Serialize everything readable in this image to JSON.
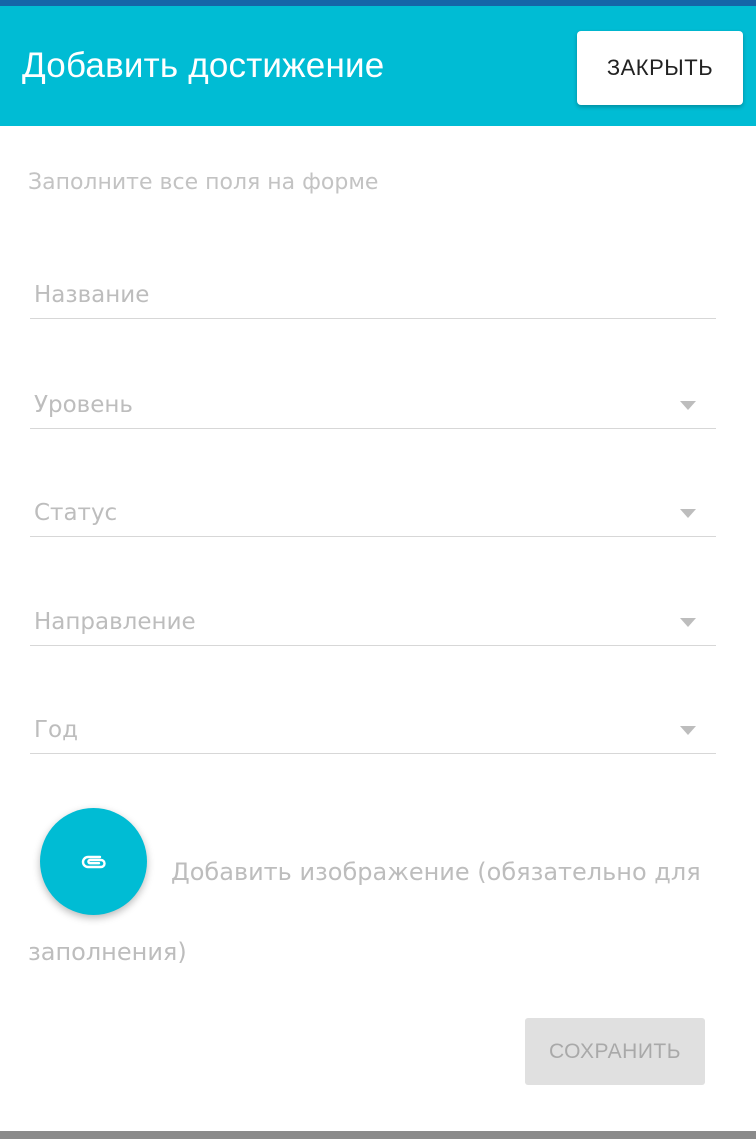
{
  "dialog": {
    "title": "Добавить достижение",
    "close_label": "ЗАКРЫТЬ",
    "hint": "Заполните все поля на форме"
  },
  "fields": [
    {
      "label": "Название",
      "type": "text"
    },
    {
      "label": "Уровень",
      "type": "select"
    },
    {
      "label": "Статус",
      "type": "select"
    },
    {
      "label": "Направление",
      "type": "select"
    },
    {
      "label": "Год",
      "type": "select"
    }
  ],
  "attachment": {
    "label": "Добавить изображение (обязательно для заполнения)",
    "icon": "paperclip-icon"
  },
  "actions": {
    "save_label": "СОХРАНИТЬ",
    "save_disabled": true
  },
  "colors": {
    "header": "#00bcd4",
    "fab": "#00bcd4",
    "top_strip": "#1565a8",
    "save_disabled_bg": "#e0e0e0",
    "placeholder_text": "#bdbdbd"
  }
}
